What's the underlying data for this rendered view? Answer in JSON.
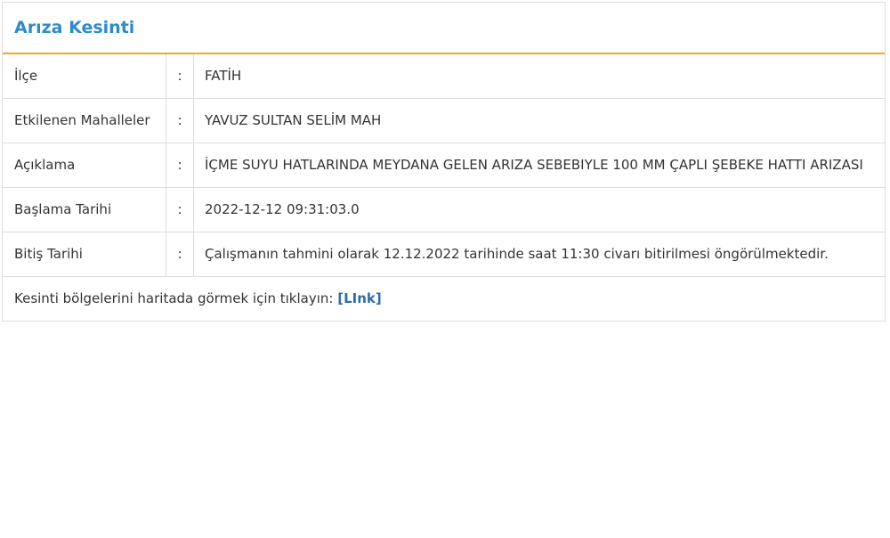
{
  "panel": {
    "title": "Arıza Kesinti"
  },
  "rows": [
    {
      "label": "İlçe",
      "separator": ":",
      "value": "FATİH"
    },
    {
      "label": "Etkilenen Mahalleler",
      "separator": ":",
      "value": "YAVUZ SULTAN SELİM MAH"
    },
    {
      "label": "Açıklama",
      "separator": ":",
      "value": "İÇME SUYU HATLARINDA MEYDANA GELEN ARIZA SEBEBIYLE 100 MM ÇAPLI ŞEBEKE HATTI ARIZASI"
    },
    {
      "label": "Başlama Tarihi",
      "separator": ":",
      "value": "2022-12-12 09:31:03.0"
    },
    {
      "label": "Bitiş Tarihi",
      "separator": ":",
      "value": "Çalışmanın tahmini olarak 12.12.2022 tarihinde saat 11:30 civarı bitirilmesi öngörülmektedir."
    }
  ],
  "footer": {
    "text": "Kesinti bölgelerini haritada görmek için tıklayın: ",
    "bracket_open": "[",
    "link_label": "LInk",
    "bracket_close": "]"
  },
  "colors": {
    "title": "#2e8bc9",
    "accent_border": "#f5a623",
    "link": "#2e6ea8"
  }
}
